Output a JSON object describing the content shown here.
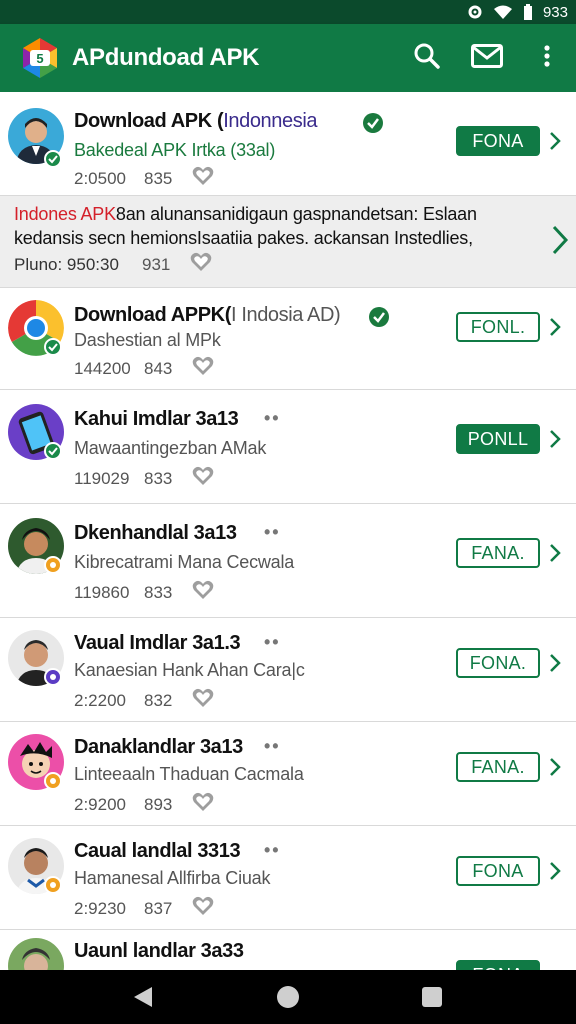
{
  "status_bar": {
    "time": "933",
    "icons": [
      "settings-icon",
      "wifi-icon",
      "battery-icon"
    ]
  },
  "app_bar": {
    "title": "APdundoad APK",
    "actions": [
      "search-icon",
      "mail-icon",
      "more-vert-icon"
    ]
  },
  "rows": [
    {
      "title": "Download APK (",
      "title_accent": "Indonnesia",
      "subtitle": "Bakedeal APK Irtka (33al)",
      "count": "2:0500",
      "num": "835",
      "button": "FONA",
      "button_style": "filled",
      "verified": true
    },
    {
      "line1_red": "Indones APK",
      "line1": "8an alunansanidigaun gaspnandetsan: Eslaan",
      "line2": "kedansis secn hemionsIsaatiia pakes. ackansan Instedlies,",
      "line3": "Pluno: 950:30",
      "num": "931"
    },
    {
      "title": "Download APPK(",
      "title_accent": "I Indosia AD)",
      "subtitle": "Dashestian al MPk",
      "count": "144200",
      "num": "843",
      "button": "FONL.",
      "button_style": "outline",
      "verified": true
    },
    {
      "title": "Kahui Imdlar 3a13",
      "subtitle": "Mawaantingezban AMak",
      "count": "119029",
      "num": "833",
      "button": "PONLL",
      "button_style": "filled"
    },
    {
      "title": "Dkenhandlal 3a13",
      "subtitle": "Kibrecatrami Mana Cecwala",
      "count": "119860",
      "num": "833",
      "button": "FANA.",
      "button_style": "outline"
    },
    {
      "title": "Vaual Imdlar 3a1.3",
      "subtitle": "Kanaesian Hank Ahan Cara|c",
      "count": "2:2200",
      "num": "832",
      "button": "FONA.",
      "button_style": "outline"
    },
    {
      "title": "Danaklandlar 3a13",
      "subtitle": "Linteeaaln Thaduan Cacmala",
      "count": "2:9200",
      "num": "893",
      "button": "FANA.",
      "button_style": "outline"
    },
    {
      "title": "Caual landlal 3313",
      "subtitle": "Hamanesal Allfirba Ciuak",
      "count": "2:9230",
      "num": "837",
      "button": "FONA",
      "button_style": "outline"
    },
    {
      "title": "Uaunl landlar 3a33",
      "button": "FONA",
      "button_style": "filled"
    }
  ],
  "colors": {
    "primary": "#107a45",
    "status_bar": "#0b4a2c",
    "accent_red": "#d4202a",
    "accent_purple": "#3a2b8c"
  },
  "nav": [
    "back-icon",
    "home-icon",
    "recents-icon"
  ]
}
